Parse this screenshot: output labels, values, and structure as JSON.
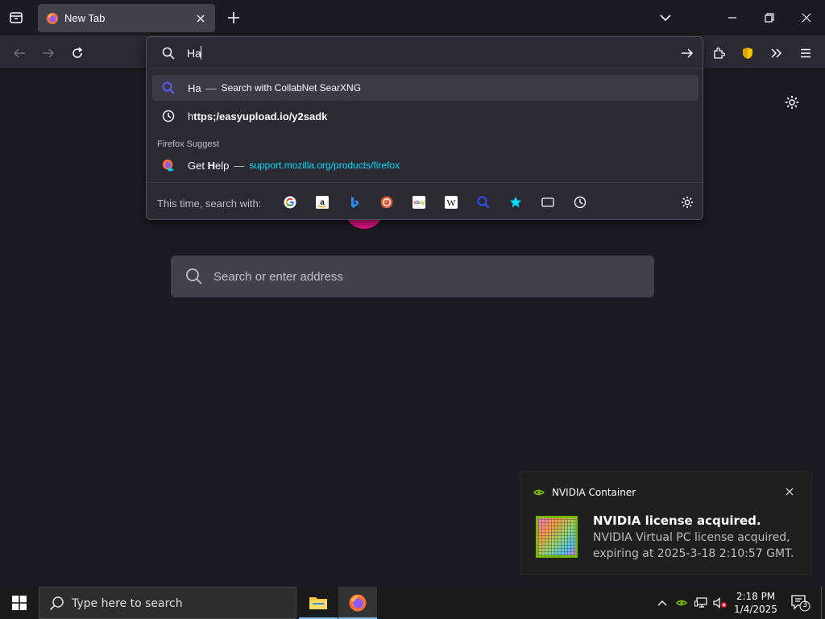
{
  "browser": {
    "tab": {
      "title": "New Tab"
    },
    "colors": {
      "accent": "#00ddff",
      "firefox_pink": "#e31587",
      "nvidia_green": "#76b900"
    }
  },
  "urlbar": {
    "value": "Ha",
    "results": [
      {
        "type": "search",
        "query": "Ha",
        "separator": "—",
        "action": "Search with CollabNet SearXNG",
        "icon": "search-icon",
        "selected": true
      },
      {
        "type": "history",
        "prefix": "h",
        "rest": "ttps;/easyupload.io/y2sadk",
        "icon": "clock-icon"
      }
    ],
    "group_label": "Firefox Suggest",
    "suggest": {
      "pre": "Get ",
      "bold": "H",
      "post": "elp",
      "separator": "—",
      "url": "support.mozilla.org/products/firefox",
      "icon": "firefox-icon"
    },
    "search_with_label": "This time, search with:",
    "engines": [
      "google-icon",
      "amazon-icon",
      "bing-icon",
      "duckduckgo-icon",
      "ebay-icon",
      "wikipedia-icon",
      "searxng-icon",
      "bookmarks-star-icon",
      "tabs-icon",
      "history-icon"
    ]
  },
  "newtab": {
    "search_placeholder": "Search or enter address"
  },
  "notification": {
    "app": "NVIDIA Container",
    "title": "NVIDIA license acquired.",
    "body": "NVIDIA Virtual PC license acquired, expiring at 2025-3-18 2:10:57 GMT."
  },
  "taskbar": {
    "search_placeholder": "Type here to search",
    "time": "2:18 PM",
    "date": "1/4/2025",
    "notification_count": "3"
  }
}
